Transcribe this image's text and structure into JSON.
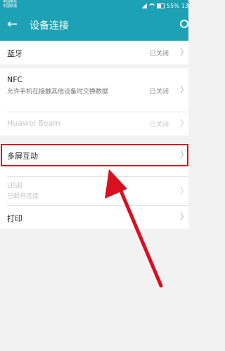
{
  "status": {
    "carrier1": "中国电信",
    "carrier2": "中国联通",
    "battery": "55%",
    "time": "13"
  },
  "header": {
    "title": "设备连接"
  },
  "items": {
    "bluetooth": {
      "label": "蓝牙",
      "value": "已关闭"
    },
    "nfc": {
      "label": "NFC",
      "desc": "允许手机在接触其他设备时交换数据",
      "value": "已关闭"
    },
    "huawei_beam": {
      "label": "Huawei Beam",
      "value": "已关闭"
    },
    "multi_screen": {
      "label": "多屏互动"
    },
    "usb": {
      "label": "USB",
      "desc": "已断开连接"
    },
    "print": {
      "label": "打印"
    }
  },
  "icons": {
    "back": "arrow-left-icon",
    "search": "search-icon",
    "chevron": "chevron-right-icon"
  },
  "colors": {
    "accent": "#1da1b4",
    "highlight": "#d81020"
  }
}
